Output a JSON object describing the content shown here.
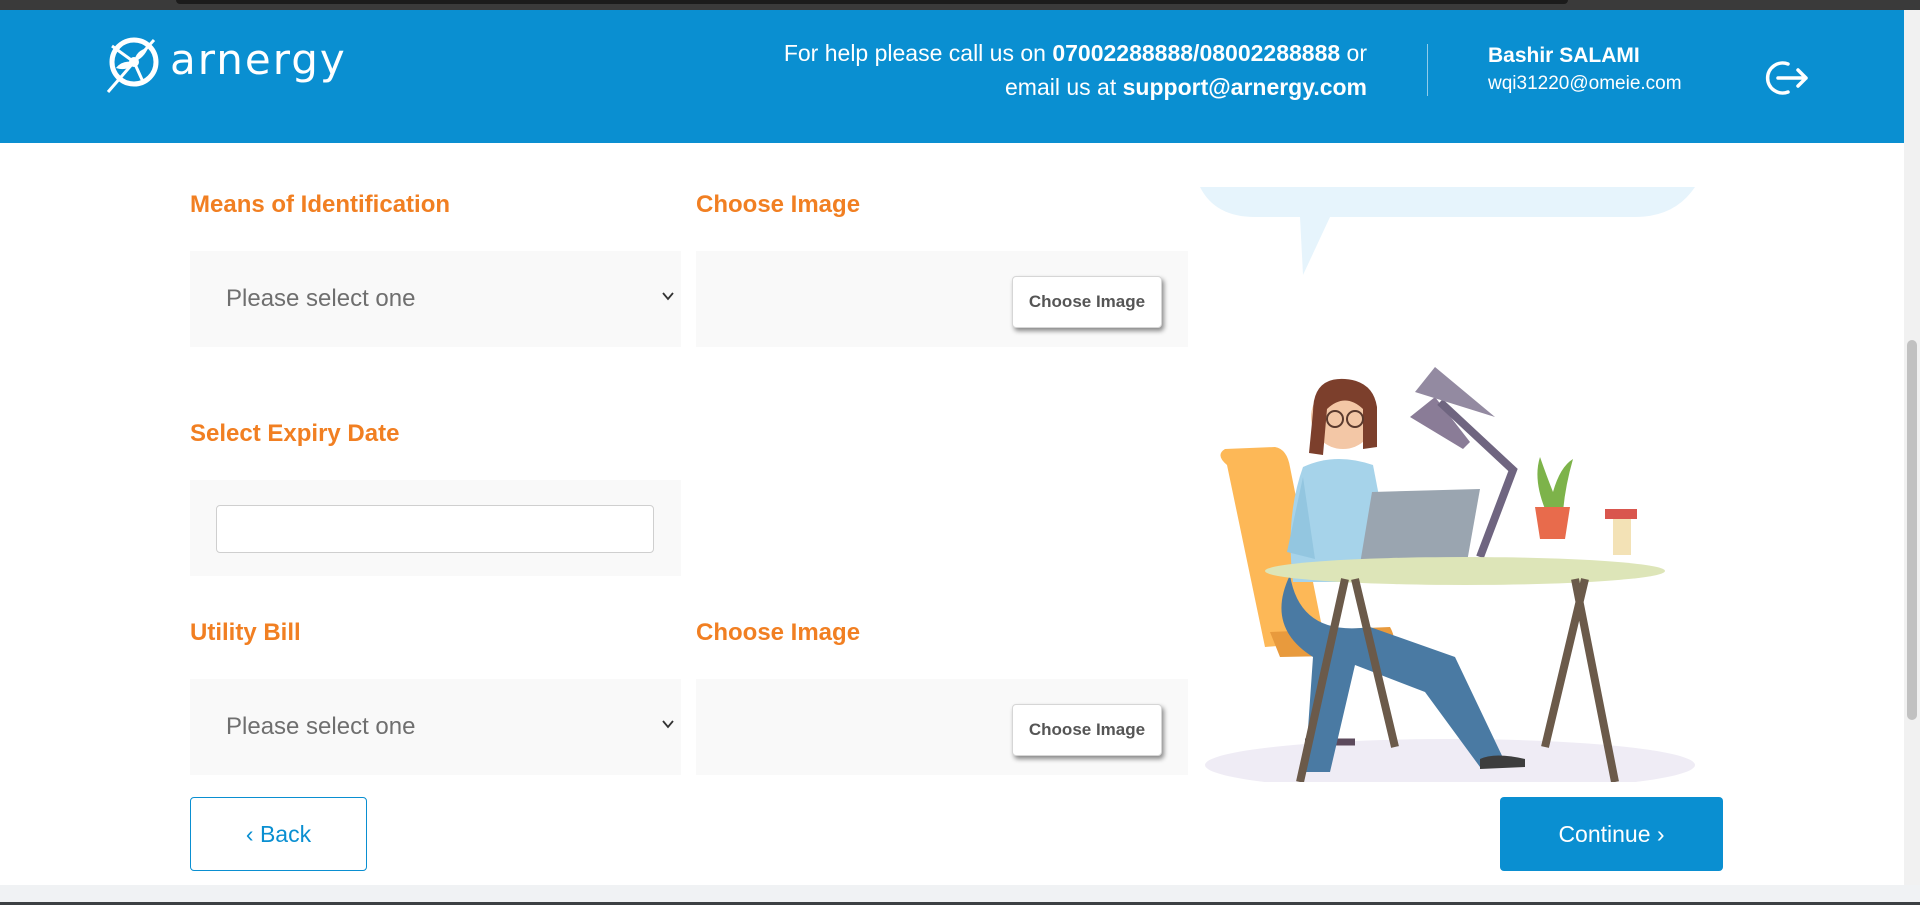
{
  "header": {
    "brand": "arnergy",
    "help_prefix": "For help please call us on",
    "help_phones": "07002288888/08002288888",
    "help_or": "or",
    "help_email_prefix": "email us at",
    "help_email": "support@arnergy.com",
    "user_name": "Bashir SALAMI",
    "user_email": "wqi31220@omeie.com",
    "logout_icon": "logout-icon"
  },
  "form": {
    "id_label": "Means of Identification",
    "id_select_value": "Please select one",
    "id_image_label": "Choose Image",
    "id_image_button": "Choose Image",
    "expiry_label": "Select Expiry Date",
    "expiry_value": "",
    "utility_label": "Utility Bill",
    "utility_select_value": "Please select one",
    "utility_image_label": "Choose Image",
    "utility_image_button": "Choose Image"
  },
  "actions": {
    "back_label": "‹ Back",
    "continue_label": "Continue ›"
  },
  "colors": {
    "brand_blue": "#0a8fd1",
    "label_orange": "#f17f22"
  }
}
